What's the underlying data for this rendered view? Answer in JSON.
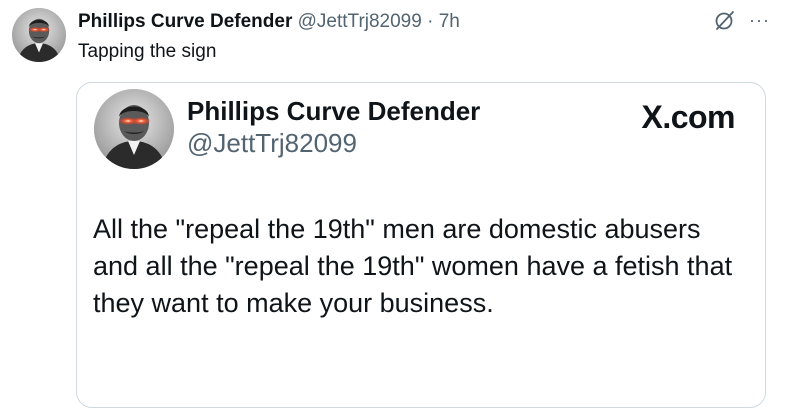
{
  "tweet": {
    "author": {
      "display_name": "Phillips Curve Defender",
      "handle": "@JettTrj82099",
      "avatar_icon": "profile-photo-laser-eyes"
    },
    "separator": "·",
    "time": "7h",
    "text": "Tapping the sign",
    "icons": {
      "grok": "grok-icon",
      "more": "···"
    }
  },
  "quoted_card": {
    "display_name": "Phillips Curve Defender",
    "handle": "@JettTrj82099",
    "logo": "X.com",
    "text": "All the \"repeal the 19th\" men are domestic abusers and all the \"repeal the 19th\" women have a fetish that they want to make your business."
  },
  "colors": {
    "text_primary": "#0f1419",
    "text_secondary": "#536471",
    "border": "#cfd9de",
    "laser_eyes": "#ff2a1a"
  }
}
